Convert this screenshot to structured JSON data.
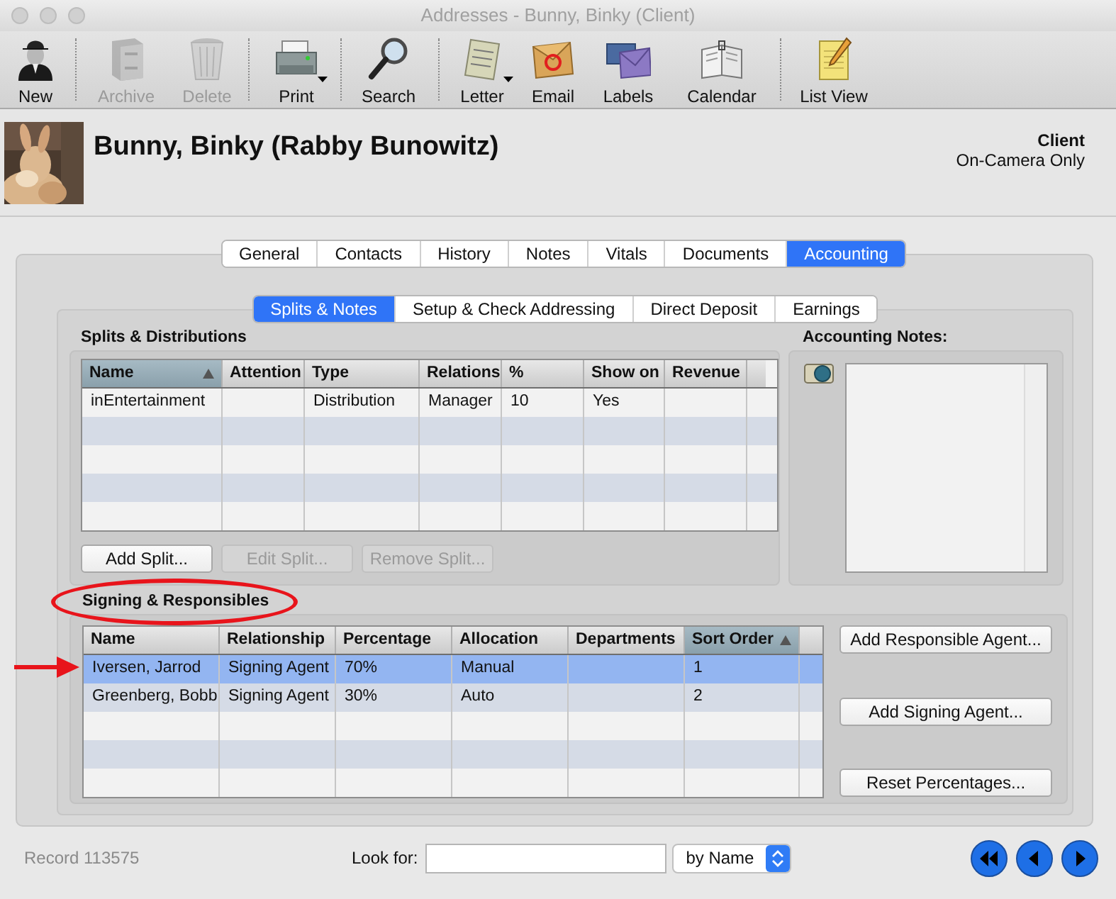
{
  "window": {
    "title": "Addresses - Bunny, Binky (Client)"
  },
  "toolbar": [
    {
      "label": "New",
      "disabled": false,
      "menu": false
    },
    {
      "label": "Archive",
      "disabled": true,
      "menu": false
    },
    {
      "label": "Delete",
      "disabled": true,
      "menu": false
    },
    {
      "label": "Print",
      "disabled": false,
      "menu": true
    },
    {
      "label": "Search",
      "disabled": false,
      "menu": false
    },
    {
      "label": "Letter",
      "disabled": false,
      "menu": true
    },
    {
      "label": "Email",
      "disabled": false,
      "menu": false
    },
    {
      "label": "Labels",
      "disabled": false,
      "menu": false
    },
    {
      "label": "Calendar",
      "disabled": false,
      "menu": false
    },
    {
      "label": "List View",
      "disabled": false,
      "menu": false
    }
  ],
  "header": {
    "name": "Bunny, Binky (Rabby Bunowitz)",
    "category": "Client",
    "subcategory": "On-Camera Only"
  },
  "tabs": [
    {
      "label": "General",
      "selected": false
    },
    {
      "label": "Contacts",
      "selected": false
    },
    {
      "label": "History",
      "selected": false
    },
    {
      "label": "Notes",
      "selected": false
    },
    {
      "label": "Vitals",
      "selected": false
    },
    {
      "label": "Documents",
      "selected": false
    },
    {
      "label": "Accounting",
      "selected": true
    }
  ],
  "subtabs": [
    {
      "label": "Splits & Notes",
      "selected": true
    },
    {
      "label": "Setup & Check Addressing",
      "selected": false
    },
    {
      "label": "Direct Deposit",
      "selected": false
    },
    {
      "label": "Earnings",
      "selected": false
    }
  ],
  "splits": {
    "title": "Splits & Distributions",
    "columns": [
      {
        "label": "Name",
        "sorted": true
      },
      {
        "label": "Attention",
        "sorted": false
      },
      {
        "label": "Type",
        "sorted": false
      },
      {
        "label": "Relations",
        "sorted": false
      },
      {
        "label": "%",
        "sorted": false
      },
      {
        "label": "Show on",
        "sorted": false
      },
      {
        "label": "Revenue",
        "sorted": false
      }
    ],
    "rows": [
      {
        "cells": [
          "inEntertainment",
          "",
          "Distribution",
          "Manager",
          "10",
          "Yes",
          ""
        ],
        "selected": false
      }
    ],
    "buttons": [
      {
        "label": "Add Split...",
        "disabled": false
      },
      {
        "label": "Edit Split...",
        "disabled": true
      },
      {
        "label": "Remove Split...",
        "disabled": true
      }
    ]
  },
  "accounting_notes": {
    "title": "Accounting Notes:"
  },
  "signing": {
    "title": "Signing & Responsibles",
    "columns": [
      {
        "label": "Name",
        "sorted": false
      },
      {
        "label": "Relationship",
        "sorted": false
      },
      {
        "label": "Percentage",
        "sorted": false
      },
      {
        "label": "Allocation",
        "sorted": false
      },
      {
        "label": "Departments",
        "sorted": false
      },
      {
        "label": "Sort Order",
        "sorted": true
      }
    ],
    "rows": [
      {
        "cells": [
          "Iversen, Jarrod",
          "Signing Agent",
          "70%",
          "Manual",
          "",
          "1"
        ],
        "selected": true
      },
      {
        "cells": [
          "Greenberg, Bobb",
          "Signing Agent",
          "30%",
          "Auto",
          "",
          "2"
        ],
        "selected": false
      }
    ],
    "buttons": [
      {
        "label": "Add Responsible Agent...",
        "disabled": false
      },
      {
        "label": "Add Signing Agent...",
        "disabled": false
      },
      {
        "label": "Reset Percentages...",
        "disabled": false
      }
    ]
  },
  "footer": {
    "record": "Record 113575",
    "look_for_label": "Look for:",
    "search_by": "by Name"
  }
}
